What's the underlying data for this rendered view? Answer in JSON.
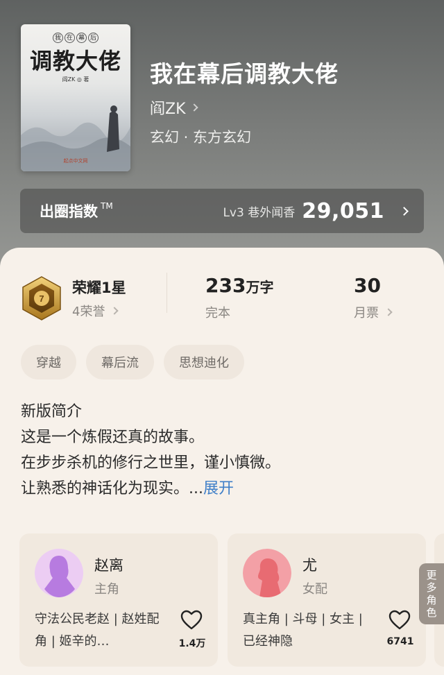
{
  "book": {
    "title": "我在幕后调教大佬",
    "author": "阎ZK",
    "genre": "玄幻 · 东方玄幻",
    "cover": {
      "top_chars": [
        "我",
        "在",
        "幕",
        "后"
      ],
      "title": "调教大佬",
      "author_line": "阎ZK ◎ 著",
      "publisher": "起点中文网"
    }
  },
  "index": {
    "label": "出圈指数",
    "tm": "TM",
    "level": "Lv3 巷外闻香",
    "value": "29,051"
  },
  "stats": {
    "honor_name": "荣耀1星",
    "honor_sub": "4荣誉",
    "badge_number": "7",
    "words_num": "233",
    "words_unit": "万字",
    "status": "完本",
    "tickets": "30",
    "tickets_label": "月票"
  },
  "tags": [
    "穿越",
    "幕后流",
    "思想迪化"
  ],
  "intro": {
    "heading": "新版简介",
    "lines": [
      "这是一个炼假还真的故事。",
      "在步步杀机的修行之世里，谨小慎微。"
    ],
    "last_line": "让熟悉的神话化为现实。...",
    "expand": "展开"
  },
  "characters": [
    {
      "name": "赵离",
      "role": "主角",
      "desc": "守法公民老赵 | 赵姓配角 | 姬辛的…",
      "likes": "1.4万",
      "avatar_color": "#b77be0"
    },
    {
      "name": "尤",
      "role": "女配",
      "desc": "真主角 | 斗母 | 女主 | 已经神隐",
      "likes": "6741",
      "avatar_color": "#e86b72"
    }
  ],
  "more_roles": "更多角色",
  "colors": {
    "accent_link": "#3f7fc8",
    "sheet_bg": "#f7f1ea",
    "card_bg": "#f1e9df"
  }
}
